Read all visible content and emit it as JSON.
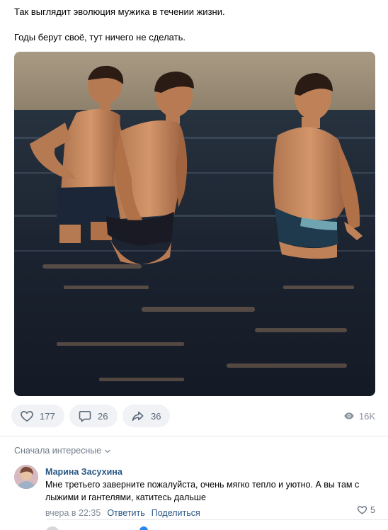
{
  "post": {
    "text_line1": "Так выглядит эволюция мужика в течении жизни.",
    "text_line2": "Годы берут своё, тут ничего не сделать."
  },
  "actions": {
    "likes": "177",
    "comments": "26",
    "shares": "36",
    "views": "16K",
    "like_icon": "heart-icon",
    "comment_icon": "speech-bubble-icon",
    "share_icon": "share-arrow-icon",
    "views_icon": "eye-icon"
  },
  "comments_section": {
    "sort_label": "Сначала интересные",
    "items": [
      {
        "author": "Марина Засухина",
        "text": "Мне третьего заверните пожалуйста, очень мягко тепло и уютно. А вы там с лыжими и гантелями, катитесь дальше",
        "time": "вчера в 22:35",
        "reply_label": "Ответить",
        "share_label": "Поделиться",
        "likes": "5"
      }
    ]
  },
  "colors": {
    "link": "#2a5885",
    "pill_bg": "#f0f2f5",
    "muted": "#818c99",
    "divider": "#e7e8ec"
  }
}
